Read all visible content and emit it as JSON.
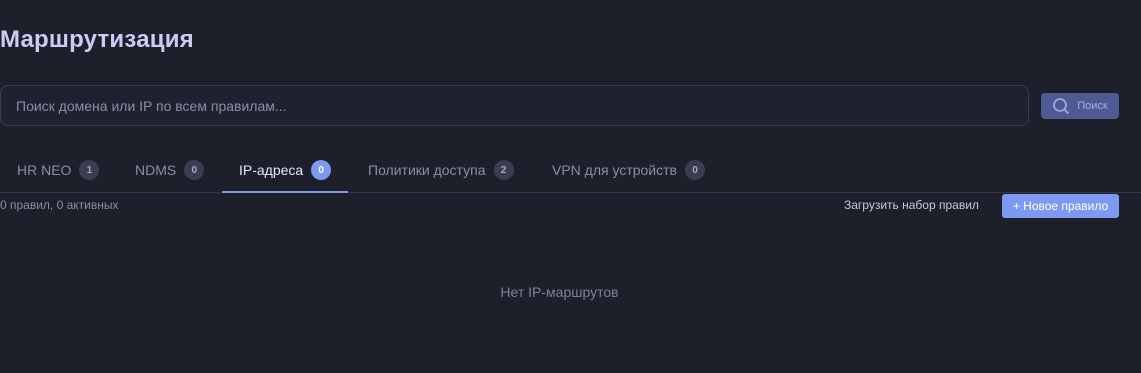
{
  "page": {
    "title": "Маршрутизация"
  },
  "search": {
    "placeholder": "Поиск домена или IP по всем правилам...",
    "value": "",
    "button_label": "Поиск",
    "button_icon": "search-icon"
  },
  "tabs": [
    {
      "label": "HR NEO",
      "count": "1",
      "active": false
    },
    {
      "label": "NDMS",
      "count": "0",
      "active": false
    },
    {
      "label": "IP-адреса",
      "count": "0",
      "active": true
    },
    {
      "label": "Политики доступа",
      "count": "2",
      "active": false
    },
    {
      "label": "VPN для устройств",
      "count": "0",
      "active": false
    }
  ],
  "toolbar": {
    "summary": "0 правил, 0 активных",
    "load_ruleset_label": "Загрузить набор правил",
    "new_rule_label": "+ Новое правило"
  },
  "empty_state": {
    "message": "Нет IP-маршрутов"
  },
  "colors": {
    "background": "#1d1f2b",
    "accent": "#7d9af0",
    "title": "#c9cdf4",
    "muted_text": "#8a8ea6"
  }
}
